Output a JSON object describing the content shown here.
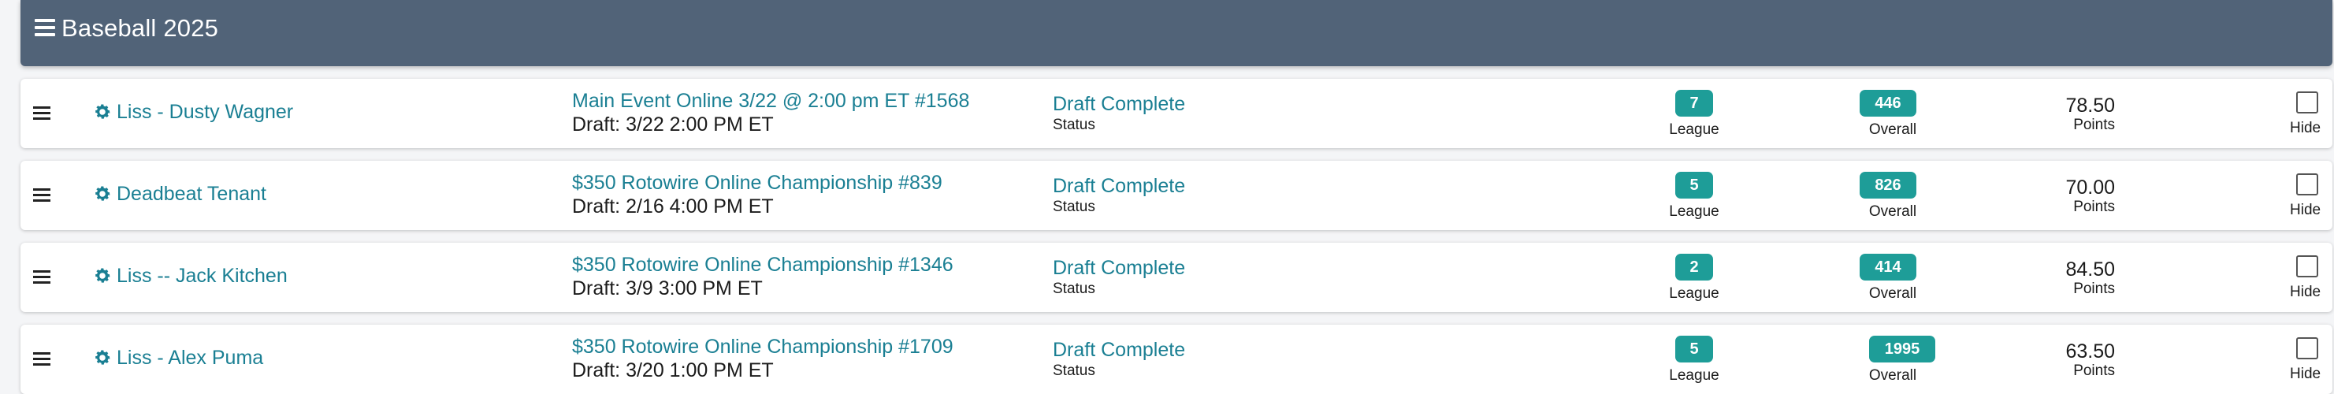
{
  "header": {
    "title": "Baseball 2025"
  },
  "labels": {
    "status": "Status",
    "league": "League",
    "overall": "Overall",
    "points": "Points",
    "hide": "Hide"
  },
  "colors": {
    "header_bg": "#516378",
    "link": "#1a7f93",
    "badge": "#1e9d98"
  },
  "teams": [
    {
      "name": "Liss - Dusty Wagner",
      "event": "Main Event Online 3/22 @ 2:00 pm ET #1568",
      "draft": "Draft: 3/22 2:00 PM ET",
      "status": "Draft Complete",
      "league_rank": "7",
      "overall_rank": "446",
      "points": "78.50",
      "hidden": false
    },
    {
      "name": "Deadbeat Tenant",
      "event": "$350 Rotowire Online Championship #839",
      "draft": "Draft: 2/16 4:00 PM ET",
      "status": "Draft Complete",
      "league_rank": "5",
      "overall_rank": "826",
      "points": "70.00",
      "hidden": false
    },
    {
      "name": "Liss -- Jack Kitchen",
      "event": "$350 Rotowire Online Championship #1346",
      "draft": "Draft: 3/9 3:00 PM ET",
      "status": "Draft Complete",
      "league_rank": "2",
      "overall_rank": "414",
      "points": "84.50",
      "hidden": false
    },
    {
      "name": "Liss - Alex Puma",
      "event": "$350 Rotowire Online Championship #1709",
      "draft": "Draft: 3/20 1:00 PM ET",
      "status": "Draft Complete",
      "league_rank": "5",
      "overall_rank": "1995",
      "points": "63.50",
      "hidden": false
    }
  ]
}
